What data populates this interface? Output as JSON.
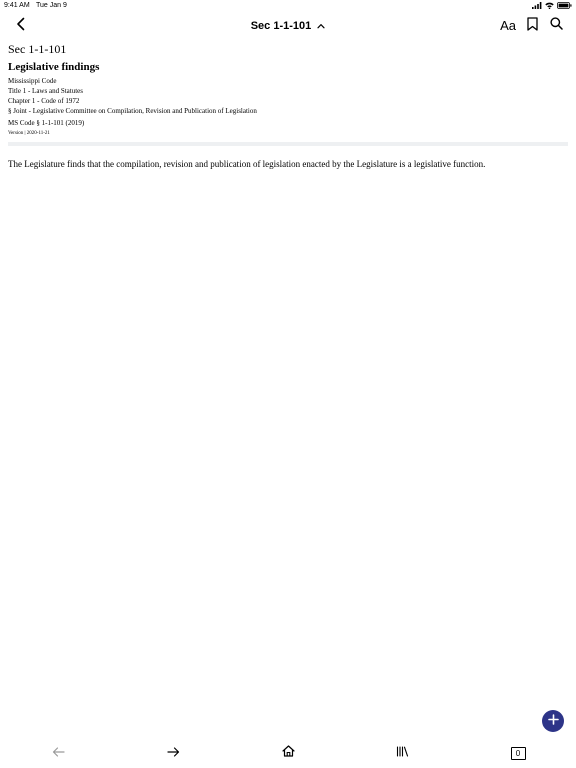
{
  "status_bar": {
    "time": "9:41 AM",
    "date": "Tue Jan 9"
  },
  "nav": {
    "title": "Sec 1-1-101",
    "font_button_label": "Aa"
  },
  "document": {
    "section_number": "Sec 1-1-101",
    "section_title": "Legislative findings",
    "breadcrumbs": [
      "Mississippi Code",
      "Title 1 - Laws and Statutes",
      "Chapter 1 - Code of 1972",
      "§ Joint - Legislative Committee on Compilation, Revision and Publication of Legislation"
    ],
    "citation": "MS Code § 1-1-101 (2019)",
    "version": "Version | 2020-11-21",
    "body": "The Legislature finds that the compilation, revision and publication of legislation enacted by the Legislature is a legislative function."
  },
  "toolbar": {
    "tabs_count": "0"
  },
  "colors": {
    "fab": "#2d3488",
    "divider": "#eef0f2",
    "disabled_icon": "#9a9a9a"
  }
}
